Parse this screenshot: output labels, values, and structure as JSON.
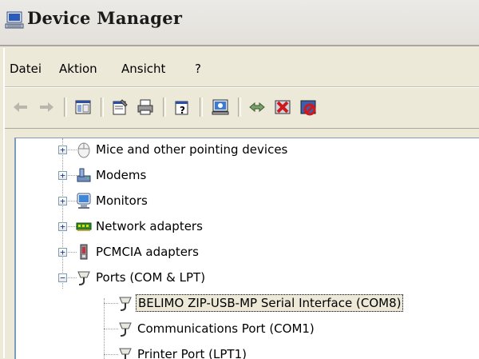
{
  "window": {
    "title": "Device Manager",
    "title_icon": "computer-icon"
  },
  "menubar": {
    "items": [
      {
        "label": "Datei"
      },
      {
        "label": "Aktion"
      },
      {
        "label": "Ansicht"
      },
      {
        "label": "?"
      }
    ]
  },
  "toolbar": {
    "buttons": [
      {
        "icon": "back-arrow-icon"
      },
      {
        "icon": "forward-arrow-icon"
      },
      {
        "icon": "show-hide-console-tree-icon"
      },
      {
        "icon": "properties-icon"
      },
      {
        "icon": "print-icon"
      },
      {
        "icon": "help-icon"
      },
      {
        "icon": "scan-hardware-changes-icon"
      },
      {
        "icon": "update-driver-icon"
      },
      {
        "icon": "uninstall-icon"
      },
      {
        "icon": "disable-icon"
      }
    ]
  },
  "tree": {
    "items": [
      {
        "label": "Mice and other pointing devices",
        "icon": "mouse-icon",
        "expanded": false
      },
      {
        "label": "Modems",
        "icon": "modem-icon",
        "expanded": false
      },
      {
        "label": "Monitors",
        "icon": "monitor-icon",
        "expanded": false
      },
      {
        "label": "Network adapters",
        "icon": "network-adapter-icon",
        "expanded": false
      },
      {
        "label": "PCMCIA adapters",
        "icon": "pcmcia-icon",
        "expanded": false
      },
      {
        "label": "Ports (COM & LPT)",
        "icon": "port-icon",
        "expanded": true,
        "children": [
          {
            "label": "BELIMO ZIP-USB-MP Serial Interface (COM8)",
            "icon": "port-icon",
            "selected": true
          },
          {
            "label": "Communications Port (COM1)",
            "icon": "port-icon"
          },
          {
            "label": "Printer Port (LPT1)",
            "icon": "port-icon"
          }
        ]
      }
    ]
  }
}
